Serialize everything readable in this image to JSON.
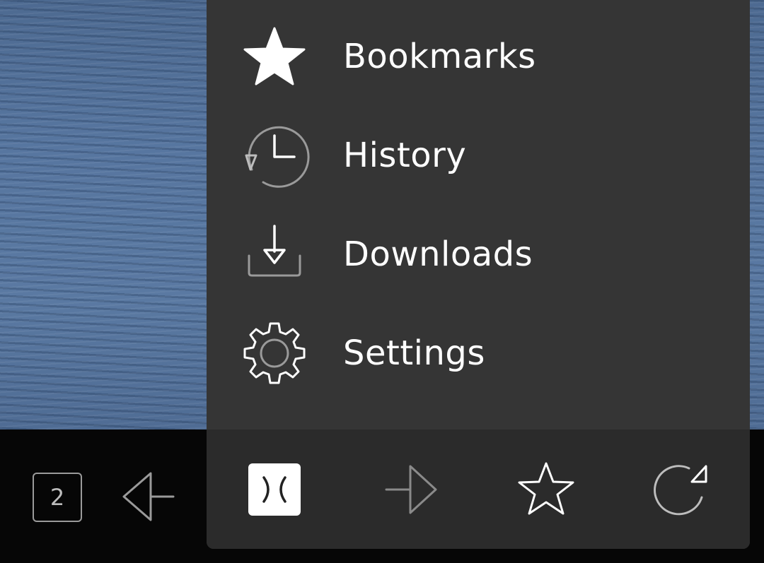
{
  "menu": {
    "items": [
      {
        "label": "Bookmarks",
        "icon": "star-filled-icon"
      },
      {
        "label": "History",
        "icon": "clock-history-icon"
      },
      {
        "label": "Downloads",
        "icon": "download-tray-icon"
      },
      {
        "label": "Settings",
        "icon": "gear-icon"
      }
    ]
  },
  "toolbar": {
    "tab_count": "2",
    "buttons": [
      {
        "name": "tabs-button",
        "icon": "tabs-count-icon"
      },
      {
        "name": "back-button",
        "icon": "back-arrow-icon"
      },
      {
        "name": "menu-button",
        "icon": "menu-collapse-icon"
      },
      {
        "name": "forward-button",
        "icon": "forward-arrow-icon"
      },
      {
        "name": "bookmark-button",
        "icon": "star-outline-icon"
      },
      {
        "name": "reload-button",
        "icon": "reload-icon"
      }
    ]
  },
  "colors": {
    "menu_background": "#353535",
    "toolbar_background": "#060606",
    "text": "#ffffff",
    "icon_muted": "#9a9a9a"
  }
}
